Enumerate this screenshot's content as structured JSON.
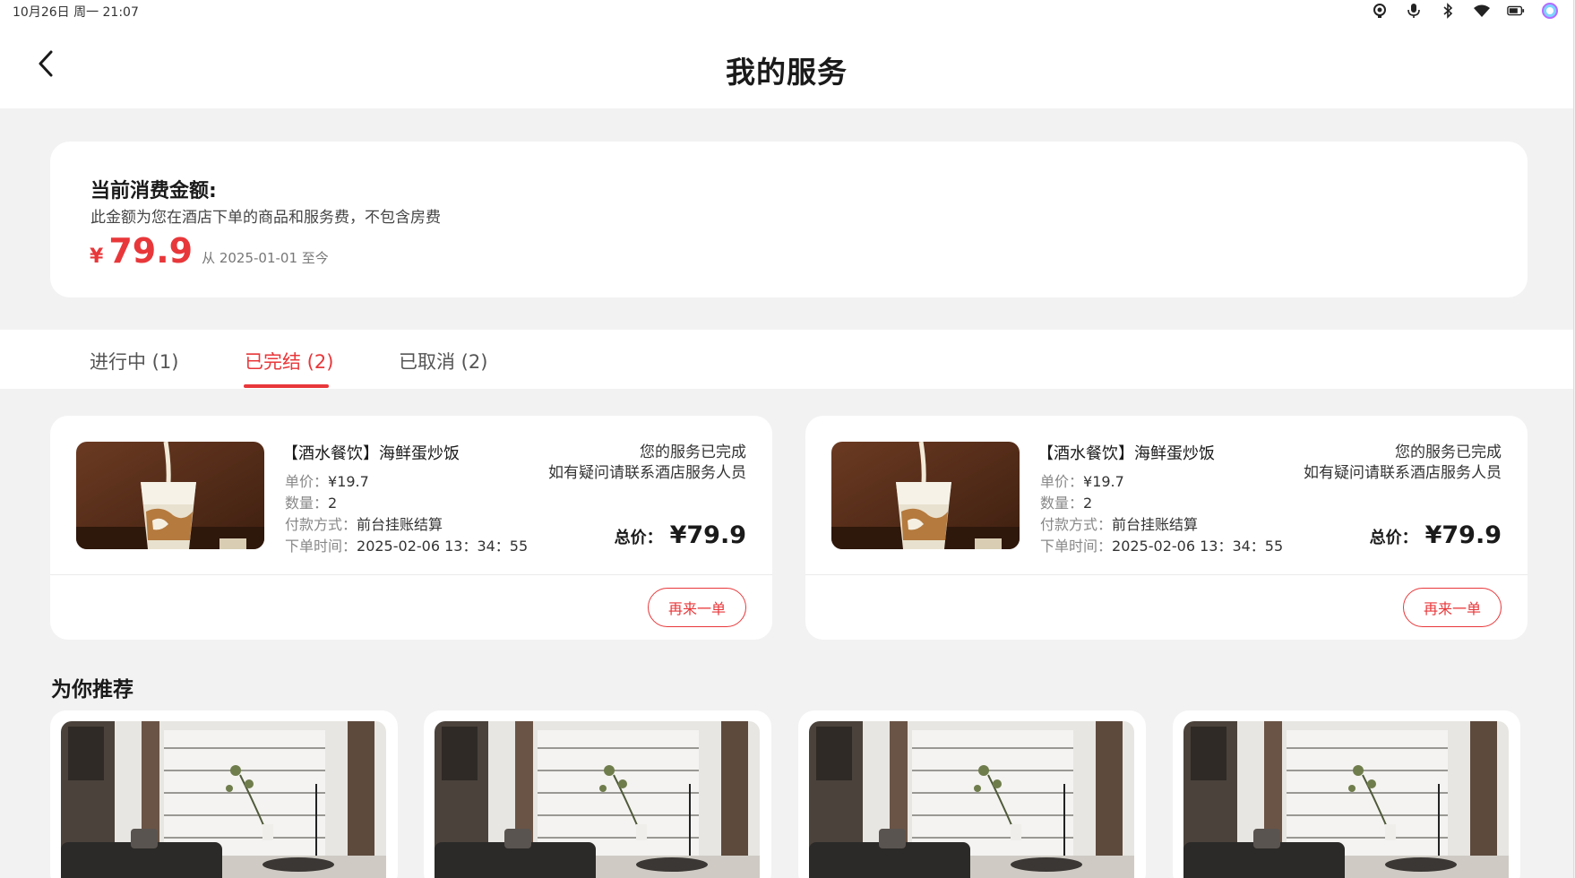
{
  "status_bar": {
    "time": "10月26日 周一   21:07",
    "icons": [
      "location-icon",
      "mic-icon",
      "bluetooth-icon",
      "wifi-icon",
      "battery-icon",
      "assistant-icon"
    ]
  },
  "header": {
    "title": "我的服务",
    "back_icon": "chevron-left-icon"
  },
  "summary": {
    "title": "当前消费金额:",
    "description": "此金额为您在酒店下单的商品和服务费，不包含房费",
    "currency": "¥",
    "amount": "79.9",
    "since": "从 2025-01-01 至今",
    "accent_color": "#e8373a"
  },
  "tabs": [
    {
      "label": "进行中 (1)",
      "active": false
    },
    {
      "label": "已完结 (2)",
      "active": true
    },
    {
      "label": "已取消 (2)",
      "active": false
    }
  ],
  "orders": [
    {
      "name": "【酒水餐饮】海鲜蛋炒饭",
      "price_label": "单价：",
      "price": "¥19.7",
      "qty_label": "数量：",
      "qty": "2",
      "pay_label": "付款方式：",
      "pay": "前台挂账结算",
      "time_label": "下单时间：",
      "time": "2025-02-06 13：34：55",
      "status_line1": "您的服务已完成",
      "status_line2": "如有疑问请联系酒店服务人员",
      "total_label": "总价：",
      "total": "¥79.9",
      "button": "再来一单"
    },
    {
      "name": "【酒水餐饮】海鲜蛋炒饭",
      "price_label": "单价：",
      "price": "¥19.7",
      "qty_label": "数量：",
      "qty": "2",
      "pay_label": "付款方式：",
      "pay": "前台挂账结算",
      "time_label": "下单时间：",
      "time": "2025-02-06 13：34：55",
      "status_line1": "您的服务已完成",
      "status_line2": "如有疑问请联系酒店服务人员",
      "total_label": "总价：",
      "total": "¥79.9",
      "button": "再来一单"
    }
  ],
  "recommend": {
    "title": "为你推荐",
    "count": 4
  }
}
